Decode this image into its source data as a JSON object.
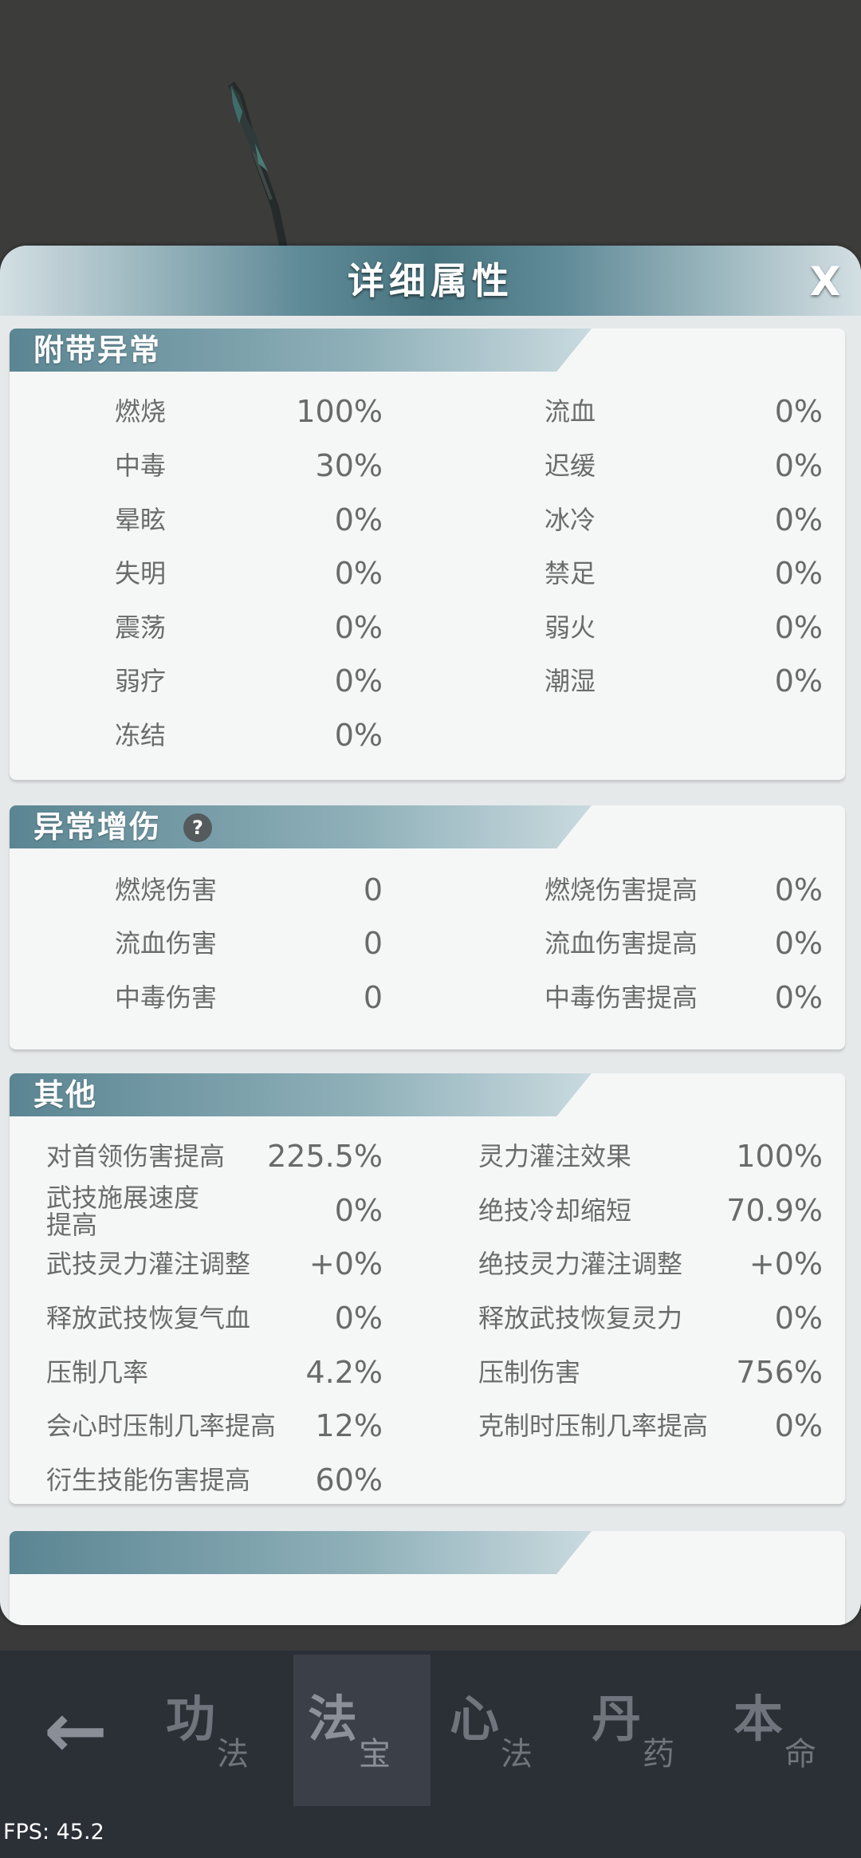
{
  "dialog": {
    "title": "详细属性",
    "close_label": "X"
  },
  "sections": {
    "abnormal": {
      "title": "附带异常",
      "left": [
        {
          "label": "燃烧",
          "value": "100%"
        },
        {
          "label": "中毒",
          "value": "30%"
        },
        {
          "label": "晕眩",
          "value": "0%"
        },
        {
          "label": "失明",
          "value": "0%"
        },
        {
          "label": "震荡",
          "value": "0%"
        },
        {
          "label": "弱疗",
          "value": "0%"
        },
        {
          "label": "冻结",
          "value": "0%"
        }
      ],
      "right": [
        {
          "label": "流血",
          "value": "0%"
        },
        {
          "label": "迟缓",
          "value": "0%"
        },
        {
          "label": "冰冷",
          "value": "0%"
        },
        {
          "label": "禁足",
          "value": "0%"
        },
        {
          "label": "弱火",
          "value": "0%"
        },
        {
          "label": "潮湿",
          "value": "0%"
        }
      ]
    },
    "abnormal_damage": {
      "title": "异常增伤",
      "help_icon": "?",
      "left": [
        {
          "label": "燃烧伤害",
          "value": "0"
        },
        {
          "label": "流血伤害",
          "value": "0"
        },
        {
          "label": "中毒伤害",
          "value": "0"
        }
      ],
      "right": [
        {
          "label": "燃烧伤害提高",
          "value": "0%"
        },
        {
          "label": "流血伤害提高",
          "value": "0%"
        },
        {
          "label": "中毒伤害提高",
          "value": "0%"
        }
      ]
    },
    "other": {
      "title": "其他",
      "left": [
        {
          "label": "对首领伤害提高",
          "value": "225.5%"
        },
        {
          "label": "武技施展速度",
          "label2": "提高",
          "value": "0%"
        },
        {
          "label": "武技灵力灌注调整",
          "value": "+0%"
        },
        {
          "label": "释放武技恢复气血",
          "value": "0%"
        },
        {
          "label": "压制几率",
          "value": "4.2%"
        },
        {
          "label": "会心时压制几率提高",
          "value": "12%"
        },
        {
          "label": "衍生技能伤害提高",
          "value": "60%"
        }
      ],
      "right": [
        {
          "label": "灵力灌注效果",
          "value": "100%"
        },
        {
          "label": "绝技冷却缩短",
          "value": "70.9%"
        },
        {
          "label": "绝技灵力灌注调整",
          "value": "+0%"
        },
        {
          "label": "释放武技恢复灵力",
          "value": "0%"
        },
        {
          "label": "压制伤害",
          "value": "756%"
        },
        {
          "label": "克制时压制几率提高",
          "value": "0%"
        }
      ]
    }
  },
  "bottom_nav": {
    "back_icon": "arrow-left-icon",
    "back_glyph": "←",
    "tabs": [
      {
        "big": "功",
        "small": "法"
      },
      {
        "big": "法",
        "small": "宝"
      },
      {
        "big": "心",
        "small": "法"
      },
      {
        "big": "丹",
        "small": "药"
      },
      {
        "big": "本",
        "small": "命"
      }
    ]
  },
  "fps": "FPS: 45.2"
}
